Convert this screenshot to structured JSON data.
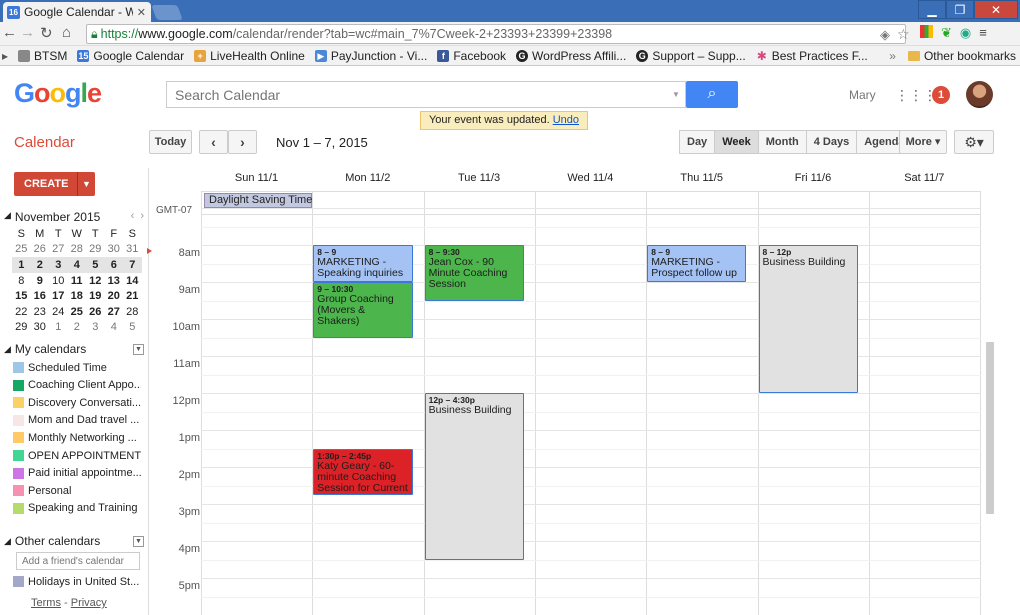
{
  "browser": {
    "tab_title": "Google Calendar - W",
    "tab_favicon": "16",
    "url_https": "https://",
    "url_host": "www.google.com",
    "url_rest": "/calendar/render?tab=wc#main_7%7Cweek-2+23393+23399+23398",
    "bookmarks": [
      {
        "label": "BTSM",
        "icon": "page-icon",
        "color": "#888888"
      },
      {
        "label": "Google Calendar",
        "icon": "calendar-icon",
        "color": "#3c78d8"
      },
      {
        "label": "LiveHealth Online",
        "icon": "health-icon",
        "color": "#e8a33d"
      },
      {
        "label": "PayJunction - Vi...",
        "icon": "payjunction-icon",
        "color": "#4a8ad4"
      },
      {
        "label": "Facebook",
        "icon": "facebook-icon",
        "color": "#3b5998"
      },
      {
        "label": "WordPress Affili...",
        "icon": "circle-g-icon",
        "color": "#222222"
      },
      {
        "label": "Support – Supp...",
        "icon": "circle-g-icon",
        "color": "#222222"
      },
      {
        "label": "Best Practices F...",
        "icon": "flower-icon",
        "color": "#d6487e"
      }
    ],
    "other_bookmarks": "Other bookmarks"
  },
  "header": {
    "logo": "Google",
    "search_placeholder": "Search Calendar",
    "user_name": "Mary",
    "notification_count": "1",
    "toast_text": "Your event was updated.",
    "toast_undo": "Undo"
  },
  "toolbar": {
    "app_title": "Calendar",
    "today": "Today",
    "date_range": "Nov 1 – 7, 2015",
    "views": [
      "Day",
      "Week",
      "Month",
      "4 Days",
      "Agenda"
    ],
    "active_view": "Week",
    "more": "More ▾"
  },
  "sidebar": {
    "create": "CREATE",
    "mini_month_title": "November 2015",
    "weekday_letters": [
      "S",
      "M",
      "T",
      "W",
      "T",
      "F",
      "S"
    ],
    "mini_weeks": [
      [
        [
          "25",
          "o"
        ],
        [
          "26",
          "o"
        ],
        [
          "27",
          "o"
        ],
        [
          "28",
          "o"
        ],
        [
          "29",
          "o"
        ],
        [
          "30",
          "o"
        ],
        [
          "31",
          "o"
        ]
      ],
      [
        [
          "1",
          "w"
        ],
        [
          "2",
          "w"
        ],
        [
          "3",
          "w"
        ],
        [
          "4",
          "w"
        ],
        [
          "5",
          "w"
        ],
        [
          "6",
          "w"
        ],
        [
          "7",
          "w"
        ]
      ],
      [
        [
          "8",
          ""
        ],
        [
          "9",
          "b"
        ],
        [
          "10",
          ""
        ],
        [
          "11",
          "b"
        ],
        [
          "12",
          "b"
        ],
        [
          "13",
          "b"
        ],
        [
          "14",
          "b"
        ]
      ],
      [
        [
          "15",
          "b"
        ],
        [
          "16",
          "b"
        ],
        [
          "17",
          "b"
        ],
        [
          "18",
          "b"
        ],
        [
          "19",
          "b"
        ],
        [
          "20",
          "b"
        ],
        [
          "21",
          "b"
        ]
      ],
      [
        [
          "22",
          ""
        ],
        [
          "23",
          ""
        ],
        [
          "24",
          ""
        ],
        [
          "25",
          "b"
        ],
        [
          "26",
          "b"
        ],
        [
          "27",
          "b"
        ],
        [
          "28",
          ""
        ]
      ],
      [
        [
          "29",
          ""
        ],
        [
          "30",
          ""
        ],
        [
          "1",
          "o"
        ],
        [
          "2",
          "o"
        ],
        [
          "3",
          "o"
        ],
        [
          "4",
          "o"
        ],
        [
          "5",
          "o"
        ]
      ]
    ],
    "my_calendars_title": "My calendars",
    "my_calendars": [
      {
        "name": "Scheduled Time",
        "color": "#9fc6e7"
      },
      {
        "name": "Coaching Client Appo...",
        "color": "#16a765"
      },
      {
        "name": "Discovery Conversati...",
        "color": "#fad165"
      },
      {
        "name": "Mom and Dad travel ...",
        "color": "#f7e6e6"
      },
      {
        "name": "Monthly Networking ...",
        "color": "#ffc966"
      },
      {
        "name": "OPEN APPOINTMENT",
        "color": "#42d692"
      },
      {
        "name": "Paid initial appointme...",
        "color": "#cd74e6"
      },
      {
        "name": "Personal",
        "color": "#f691b2"
      },
      {
        "name": "Speaking and Training",
        "color": "#b3dc6c"
      }
    ],
    "other_calendars_title": "Other calendars",
    "add_friend_placeholder": "Add a friend's calendar",
    "other_calendars": [
      {
        "name": "Holidays in United St...",
        "color": "#a4a8c8"
      }
    ],
    "terms": "Terms",
    "privacy": "Privacy"
  },
  "week": {
    "days": [
      "Sun 11/1",
      "Mon 11/2",
      "Tue 11/3",
      "Wed 11/4",
      "Thu 11/5",
      "Fri 11/6",
      "Sat 11/7"
    ],
    "timezone": "GMT-07",
    "all_day_event": "Daylight Saving Time",
    "hours": [
      "8am",
      "9am",
      "10am",
      "11am",
      "12pm",
      "1pm",
      "2pm",
      "3pm",
      "4pm",
      "5pm"
    ],
    "events": [
      {
        "day": 1,
        "start": 8,
        "end": 9,
        "time": "8 – 9",
        "title": "MARKETING - Speaking inquiries",
        "bg": "#a4c2f4",
        "border": "#3c78d8",
        "fg": "#1d1d1d"
      },
      {
        "day": 1,
        "start": 9,
        "end": 10.5,
        "time": "9 – 10:30",
        "title": "Group Coaching (Movers & Shakers)",
        "bg": "#4cb64c",
        "border": "#3c78d8",
        "fg": "#1d1d1d"
      },
      {
        "day": 1,
        "start": 13.5,
        "end": 14.75,
        "time": "1:30p – 2:45p",
        "title": "Katy Geary - 60-minute Coaching Session for Current",
        "bg": "#dc2127",
        "border": "#3c78d8",
        "fg": "#1d1d1d"
      },
      {
        "day": 2,
        "start": 8,
        "end": 9.5,
        "time": "8 – 9:30",
        "title": "Jean Cox - 90 Minute Coaching Session",
        "bg": "#4cb64c",
        "border": "#3c78d8",
        "fg": "#1d1d1d"
      },
      {
        "day": 2,
        "start": 12,
        "end": 16.5,
        "time": "12p – 4:30p",
        "title": "Business Building",
        "bg": "#e1e1e1",
        "border": "#3c78d8",
        "fg": "#1d1d1d"
      },
      {
        "day": 4,
        "start": 8,
        "end": 9,
        "time": "8 – 9",
        "title": "MARKETING - Prospect follow up",
        "bg": "#a4c2f4",
        "border": "#3c78d8",
        "fg": "#1d1d1d"
      },
      {
        "day": 5,
        "start": 8,
        "end": 12,
        "time": "8 – 12p",
        "title": "Business Building",
        "bg": "#e1e1e1",
        "border": "#3c78d8",
        "fg": "#1d1d1d"
      }
    ]
  }
}
